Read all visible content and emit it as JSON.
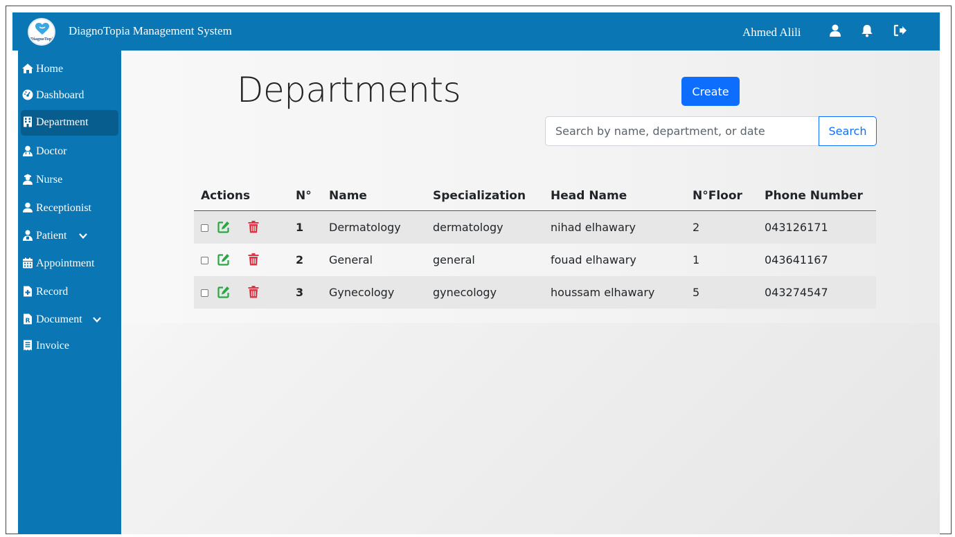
{
  "app": {
    "logo_text": "DiagnoTopia",
    "title": "DiagnoTopia Management System",
    "user_name": "Ahmed Alili"
  },
  "colors": {
    "brand": "#0b76b4",
    "active_nav": "#075d8d",
    "primary": "#0d6efd",
    "edit": "#28a745",
    "delete": "#dc3545"
  },
  "sidebar": {
    "items": [
      {
        "label": "Home",
        "icon": "home-icon"
      },
      {
        "label": "Dashboard",
        "icon": "gauge-icon"
      },
      {
        "label": "Department",
        "icon": "building-icon",
        "active": true
      },
      {
        "label": "Doctor",
        "icon": "doctor-icon"
      },
      {
        "label": "Nurse",
        "icon": "nurse-icon"
      },
      {
        "label": "Receptionist",
        "icon": "receptionist-icon"
      },
      {
        "label": "Patient",
        "icon": "patient-icon",
        "expandable": true
      },
      {
        "label": "Appointment",
        "icon": "calendar-icon"
      },
      {
        "label": "Record",
        "icon": "medical-file-icon"
      },
      {
        "label": "Document",
        "icon": "prescription-icon",
        "expandable": true
      },
      {
        "label": "Invoice",
        "icon": "receipt-icon"
      }
    ]
  },
  "page": {
    "title": "Departments",
    "create_label": "Create",
    "search_placeholder": "Search by name, department, or date",
    "search_value": "",
    "search_label": "Search"
  },
  "table": {
    "headers": [
      "Actions",
      "N°",
      "Name",
      "Specialization",
      "Head Name",
      "N°Floor",
      "Phone Number"
    ],
    "rows": [
      {
        "n": "1",
        "name": "Dermatology",
        "specialization": "dermatology",
        "head": "nihad elhawary",
        "floor": "2",
        "phone": "043126171"
      },
      {
        "n": "2",
        "name": "General",
        "specialization": "general",
        "head": "fouad elhawary",
        "floor": "1",
        "phone": "043641167"
      },
      {
        "n": "3",
        "name": "Gynecology",
        "specialization": "gynecology",
        "head": "houssam elhawary",
        "floor": "5",
        "phone": "043274547"
      }
    ]
  }
}
